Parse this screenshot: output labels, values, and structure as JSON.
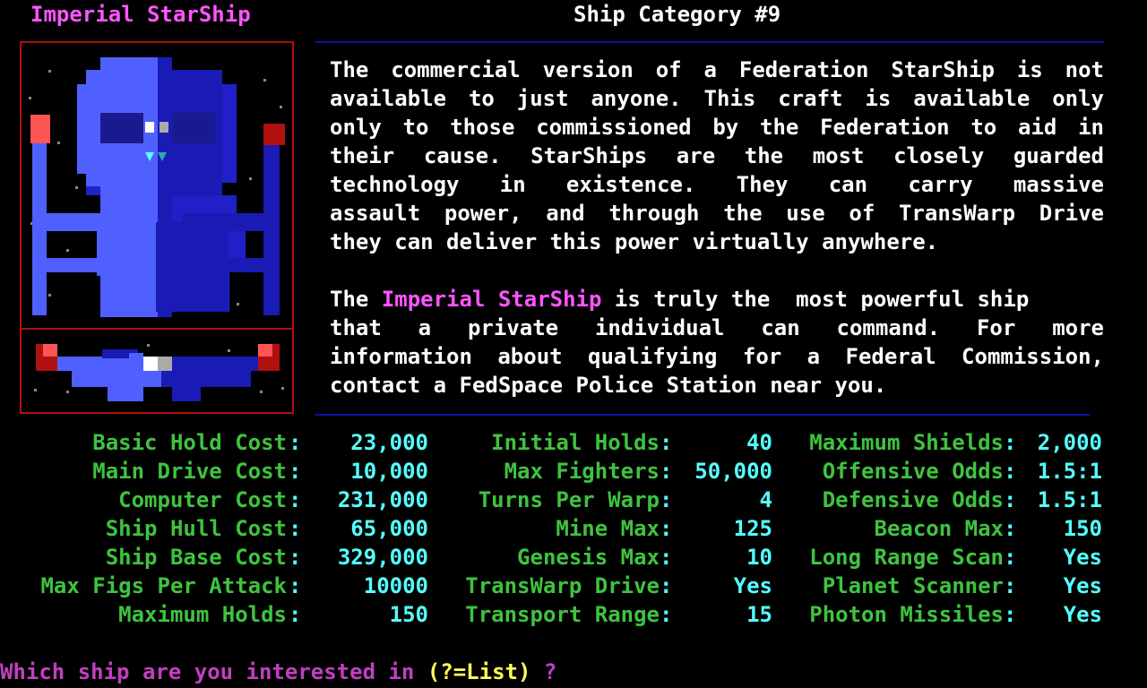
{
  "header": {
    "ship_name": "Imperial StarShip",
    "category": "Ship Category #9"
  },
  "description": {
    "p1": [
      "The commercial version of a Federation StarShip is not",
      "available to just anyone. This craft is available only",
      "only to those commissioned by the Federation to aid in",
      "their cause.  StarShips are the most closely guarded",
      "technology in existence.  They can carry massive",
      "assault power, and through the use of TransWarp Drive",
      "they can deliver this power virtually anywhere."
    ],
    "p2_line1_prefix": "The ",
    "p2_line1_highlight": "Imperial StarShip",
    "p2_line1_suffix": " is truly the  most powerful ship",
    "p2_rest": [
      "that a private individual can command.  For more",
      "information about qualifying for a Federal Commission,",
      "contact a FedSpace Police Station near you."
    ]
  },
  "stats": {
    "col1": [
      {
        "label": "Basic Hold Cost",
        "value": "23,000"
      },
      {
        "label": "Main Drive Cost",
        "value": "10,000"
      },
      {
        "label": "Computer Cost",
        "value": "231,000"
      },
      {
        "label": "Ship Hull Cost",
        "value": "65,000"
      },
      {
        "label": "Ship Base Cost",
        "value": "329,000"
      },
      {
        "label": "Max Figs Per Attack",
        "value": "10000"
      },
      {
        "label": "Maximum Holds",
        "value": "150"
      }
    ],
    "col2": [
      {
        "label": "Initial Holds",
        "value": "40"
      },
      {
        "label": "Max Fighters",
        "value": "50,000"
      },
      {
        "label": "Turns Per Warp",
        "value": "4"
      },
      {
        "label": "Mine Max",
        "value": "125"
      },
      {
        "label": "Genesis Max",
        "value": "10"
      },
      {
        "label": "TransWarp Drive",
        "value": "Yes"
      },
      {
        "label": "Transport Range",
        "value": "15"
      }
    ],
    "col3": [
      {
        "label": "Maximum Shields",
        "value": "2,000"
      },
      {
        "label": "Offensive Odds",
        "value": "1.5:1"
      },
      {
        "label": "Defensive Odds",
        "value": "1.5:1"
      },
      {
        "label": "Beacon Max",
        "value": "150"
      },
      {
        "label": "Long Range Scan",
        "value": "Yes"
      },
      {
        "label": "Planet Scanner",
        "value": "Yes"
      },
      {
        "label": "Photon Missiles",
        "value": "Yes"
      }
    ]
  },
  "prompt": {
    "text1": "Which ship are you interested in ",
    "text2": "(?=List)",
    "text3": " ?"
  },
  "colors": {
    "title_magenta": "#ff55ff",
    "label_green": "#3fc33f",
    "value_cyan": "#55ffff",
    "frame_red": "#b01010",
    "rule_blue": "#1010b0",
    "ship_blue": "#2020c0"
  }
}
